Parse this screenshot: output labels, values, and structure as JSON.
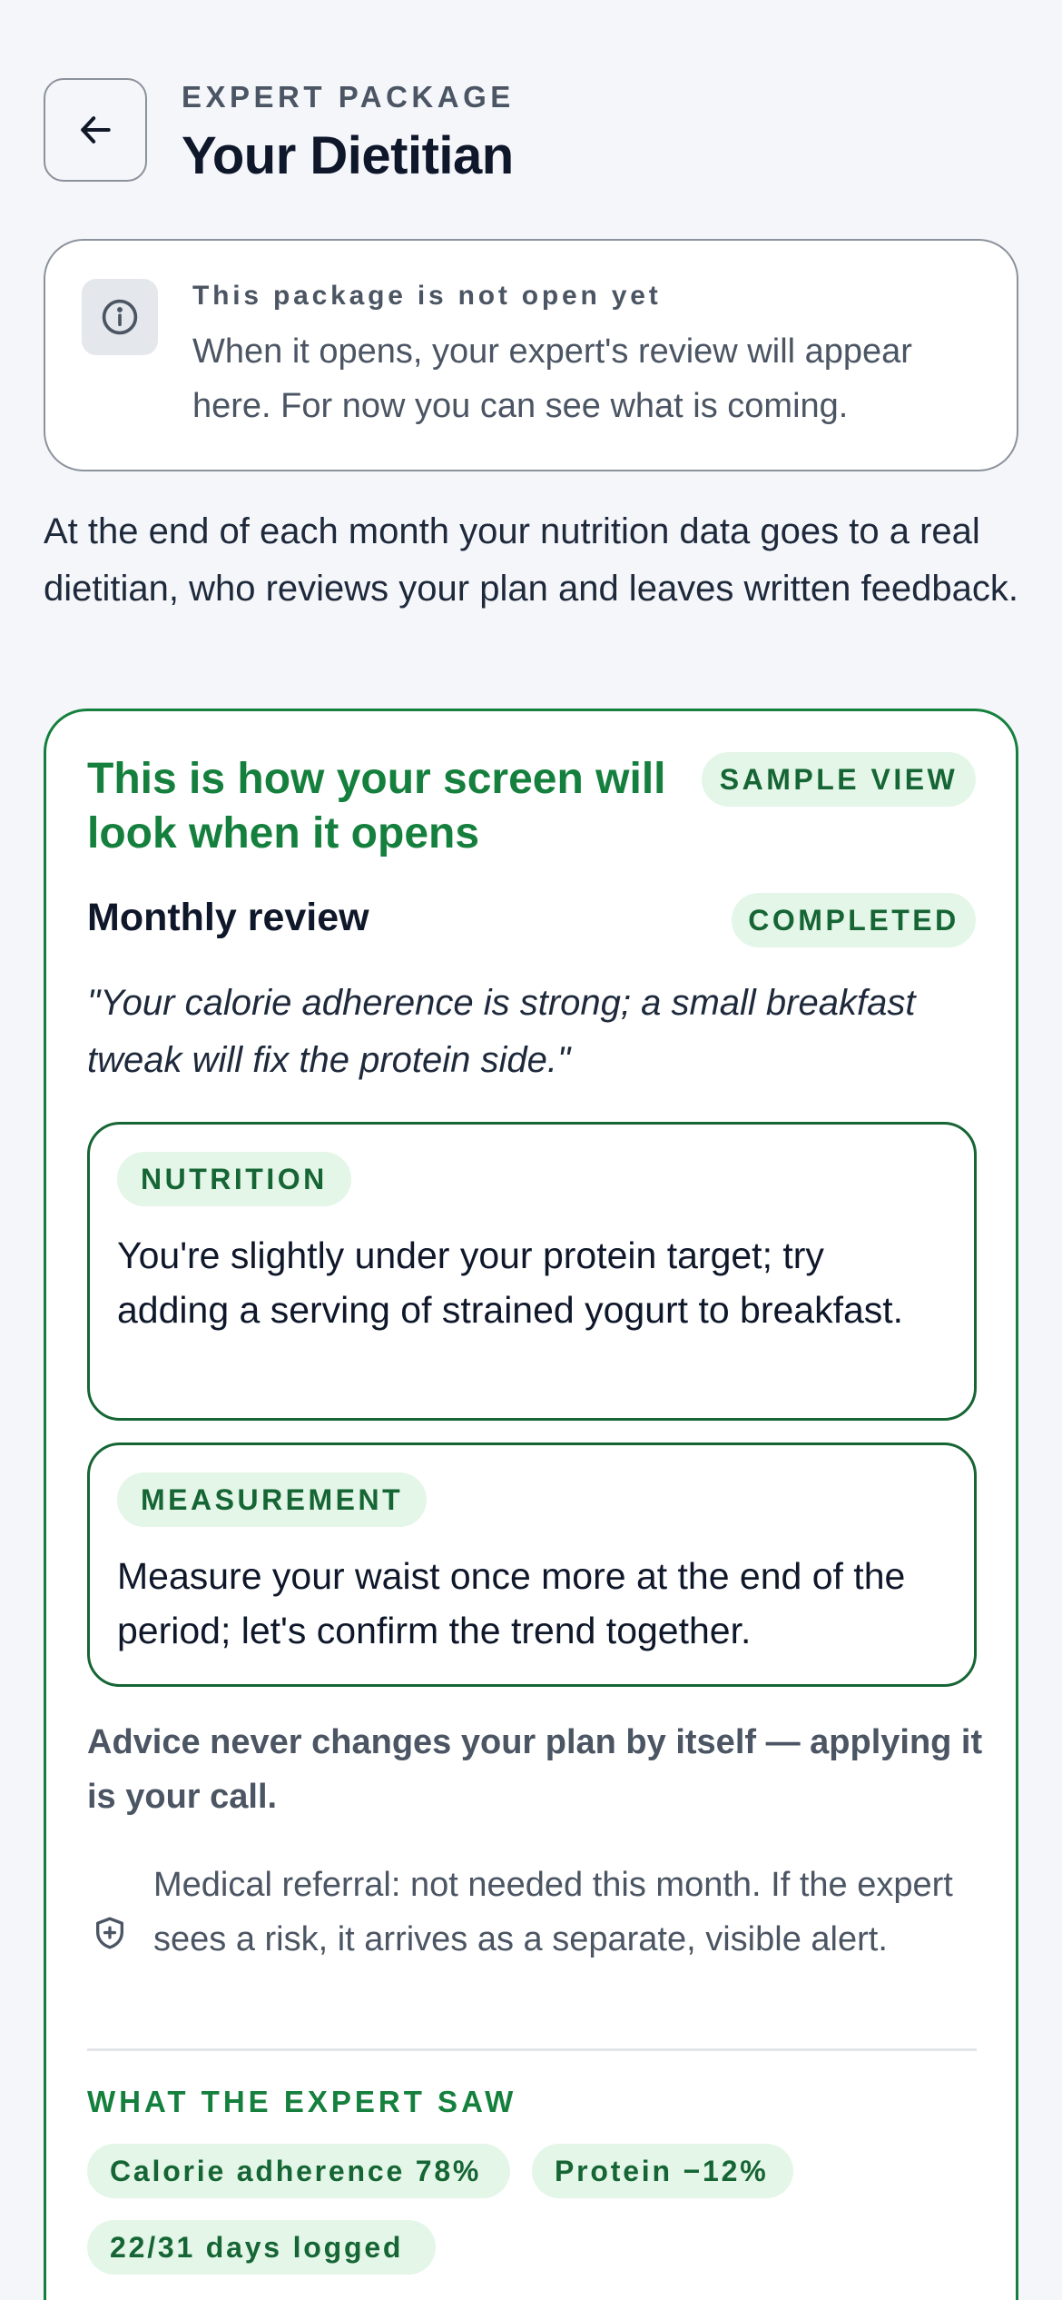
{
  "header": {
    "back_icon": "arrow-left-icon",
    "eyebrow": "EXPERT PACKAGE",
    "title": "Your Dietitian"
  },
  "notice": {
    "icon": "info-icon",
    "title": "This package is not open yet",
    "body": "When it opens, your expert's review will appear here. For now you can see what is coming."
  },
  "intro": "At the end of each month your nutrition data goes to a real dietitian, who reviews your plan and leaves written feedback.",
  "sample": {
    "heading": "This is how your screen will look when it opens",
    "badge": "SAMPLE VIEW",
    "review_title": "Monthly review",
    "status": "COMPLETED",
    "quote": "\"Your calorie adherence is strong; a small breakfast tweak will fix the protein side.\"",
    "advice": [
      {
        "tag": "NUTRITION",
        "text": "You're slightly under your protein target; try adding a serving of strained yogurt to breakfast."
      },
      {
        "tag": "MEASUREMENT",
        "text": "Measure your waist once more at the end of the period; let's confirm the trend together."
      }
    ],
    "disclaimer": "Advice never changes your plan by itself — applying it is your call.",
    "referral_icon": "shield-plus-icon",
    "referral": "Medical referral: not needed this month. If the expert sees a risk, it arrives as a separate, visible alert.",
    "saw_title": "WHAT THE EXPERT SAW",
    "chips": [
      "Calorie adherence 78%",
      "Protein −12%",
      "22/31 days logged"
    ]
  },
  "colors": {
    "accent": "#15803d",
    "accent_soft": "#e3f6e8",
    "background": "#f4f6fa",
    "muted_text": "#4b5563"
  }
}
